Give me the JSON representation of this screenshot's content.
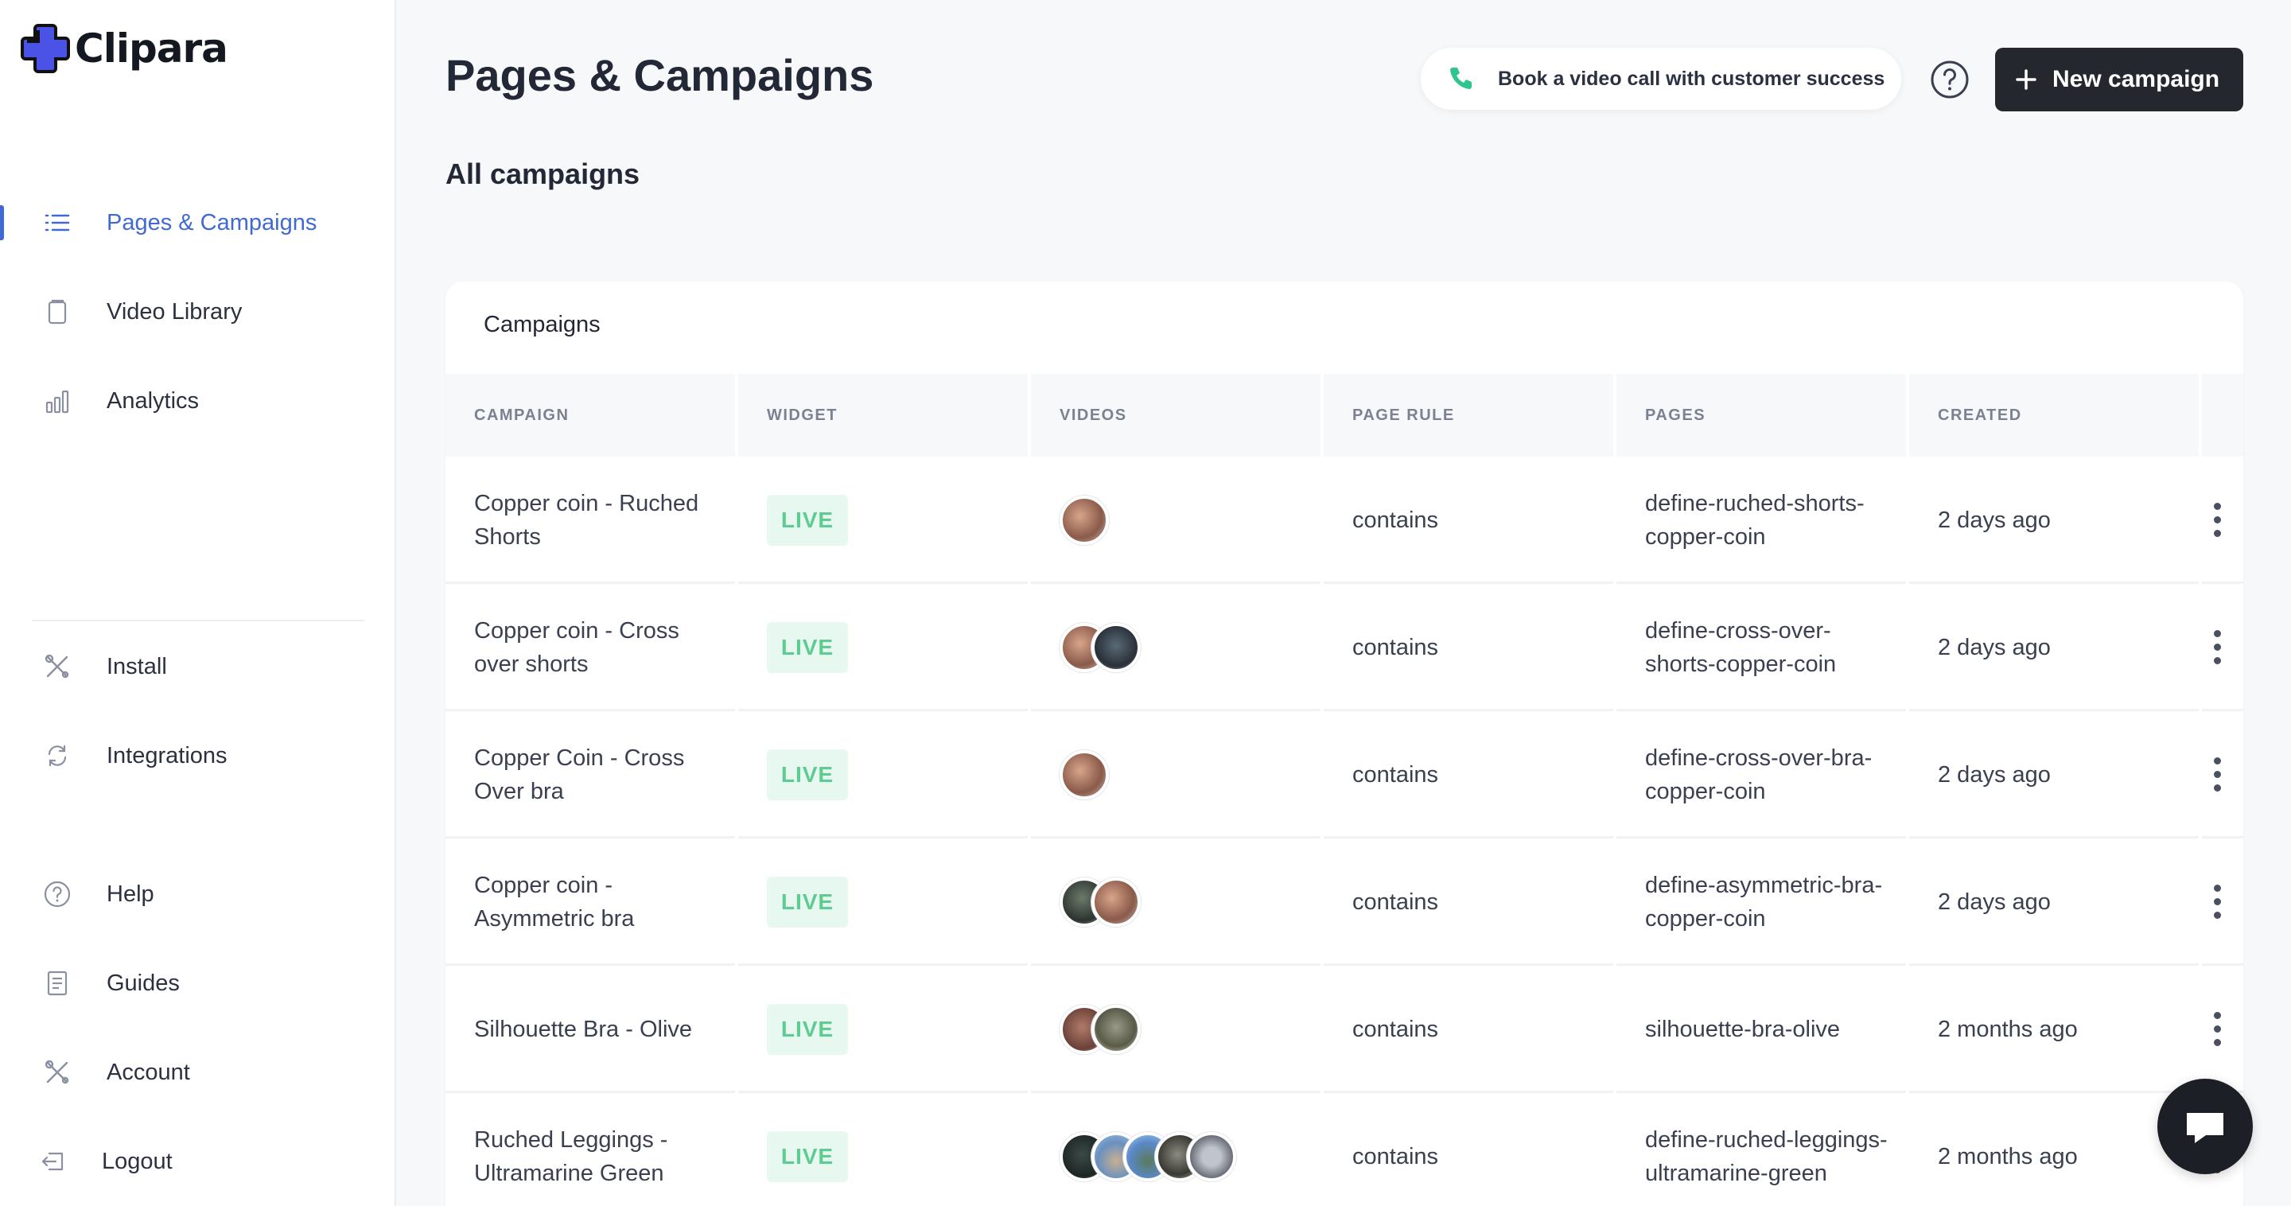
{
  "brand": {
    "name": "Clipara",
    "logo_color": "#4b53e6"
  },
  "sidebar": {
    "items": [
      {
        "label": "Pages & Campaigns",
        "icon": "list-icon",
        "active": true
      },
      {
        "label": "Video Library",
        "icon": "library-icon"
      },
      {
        "label": "Analytics",
        "icon": "bar-chart-icon"
      },
      {
        "label": "Install",
        "icon": "tools-icon"
      },
      {
        "label": "Integrations",
        "icon": "sync-icon"
      },
      {
        "label": "Help",
        "icon": "help-circle-icon"
      },
      {
        "label": "Guides",
        "icon": "document-icon"
      },
      {
        "label": "Account",
        "icon": "tools-icon"
      },
      {
        "label": "Logout",
        "icon": "logout-icon"
      }
    ]
  },
  "header": {
    "title": "Pages & Campaigns",
    "call_button": "Book a video call with customer success",
    "new_button": "New campaign",
    "accent": "#2ec58f"
  },
  "section_title": "All campaigns",
  "table": {
    "title": "Campaigns",
    "columns": [
      "CAMPAIGN",
      "WIDGET",
      "VIDEOS",
      "PAGE RULE",
      "PAGES",
      "CREATED"
    ],
    "rows": [
      {
        "campaign": "Copper coin - Ruched Shorts",
        "widget": "LIVE",
        "videos": 1,
        "rule": "contains",
        "pages": "define-ruched-shorts-copper-coin",
        "created": "2 days ago"
      },
      {
        "campaign": "Copper coin - Cross over shorts",
        "widget": "LIVE",
        "videos": 2,
        "rule": "contains",
        "pages": "define-cross-over-shorts-copper-coin",
        "created": "2 days ago"
      },
      {
        "campaign": "Copper Coin - Cross Over bra",
        "widget": "LIVE",
        "videos": 1,
        "rule": "contains",
        "pages": "define-cross-over-bra-copper-coin",
        "created": "2 days ago"
      },
      {
        "campaign": "Copper coin - Asymmetric bra",
        "widget": "LIVE",
        "videos": 2,
        "rule": "contains",
        "pages": "define-asymmetric-bra-copper-coin",
        "created": "2 days ago"
      },
      {
        "campaign": "Silhouette Bra - Olive",
        "widget": "LIVE",
        "videos": 2,
        "rule": "contains",
        "pages": "silhouette-bra-olive",
        "created": "2 months ago"
      },
      {
        "campaign": "Ruched Leggings - Ultramarine Green",
        "widget": "LIVE",
        "videos": 5,
        "rule": "contains",
        "pages": "define-ruched-leggings-ultramarine-green",
        "created": "2 months ago"
      }
    ]
  },
  "chat": {
    "icon": "chat-icon"
  }
}
